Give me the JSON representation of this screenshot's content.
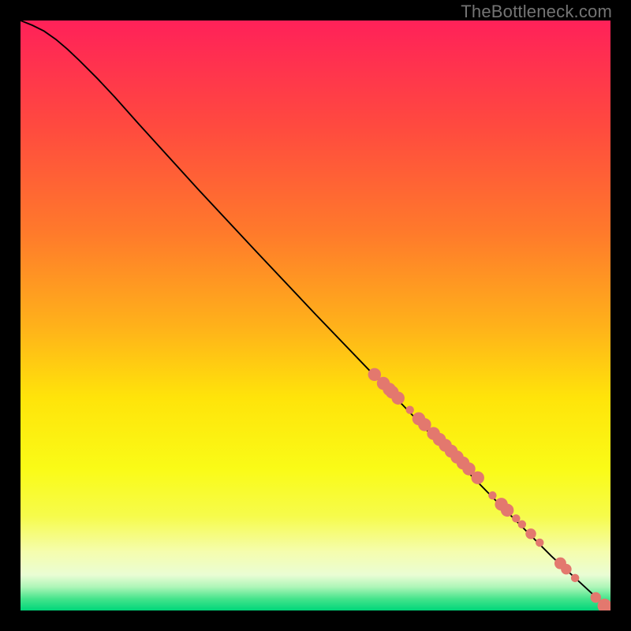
{
  "watermark": "TheBottleneck.com",
  "gradient": {
    "stops": [
      {
        "offset": 0.0,
        "color": "#ff2159"
      },
      {
        "offset": 0.18,
        "color": "#ff4a3f"
      },
      {
        "offset": 0.36,
        "color": "#ff7a2b"
      },
      {
        "offset": 0.52,
        "color": "#ffb21a"
      },
      {
        "offset": 0.64,
        "color": "#ffe40a"
      },
      {
        "offset": 0.76,
        "color": "#fafb17"
      },
      {
        "offset": 0.84,
        "color": "#f6fb4b"
      },
      {
        "offset": 0.9,
        "color": "#f5fdad"
      },
      {
        "offset": 0.94,
        "color": "#eafdd4"
      },
      {
        "offset": 0.96,
        "color": "#aef6b8"
      },
      {
        "offset": 0.98,
        "color": "#46e48c"
      },
      {
        "offset": 1.0,
        "color": "#00d67a"
      }
    ]
  },
  "chart_data": {
    "type": "line",
    "title": "",
    "xlabel": "",
    "ylabel": "",
    "xlim": [
      0,
      100
    ],
    "ylim": [
      0,
      100
    ],
    "series": [
      {
        "name": "curve",
        "points": [
          {
            "x": 0,
            "y": 100
          },
          {
            "x": 2,
            "y": 99.2
          },
          {
            "x": 4,
            "y": 98.2
          },
          {
            "x": 6,
            "y": 96.8
          },
          {
            "x": 8,
            "y": 95.1
          },
          {
            "x": 10,
            "y": 93.2
          },
          {
            "x": 13,
            "y": 90.2
          },
          {
            "x": 16,
            "y": 87.0
          },
          {
            "x": 20,
            "y": 82.5
          },
          {
            "x": 30,
            "y": 71.5
          },
          {
            "x": 40,
            "y": 60.8
          },
          {
            "x": 50,
            "y": 50.2
          },
          {
            "x": 60,
            "y": 39.8
          },
          {
            "x": 70,
            "y": 29.4
          },
          {
            "x": 80,
            "y": 19.2
          },
          {
            "x": 90,
            "y": 9.2
          },
          {
            "x": 100,
            "y": 0
          }
        ]
      }
    ],
    "scatter_points": [
      {
        "x": 60.0,
        "y": 40.0,
        "r": 1.1
      },
      {
        "x": 61.5,
        "y": 38.5,
        "r": 1.1
      },
      {
        "x": 62.5,
        "y": 37.5,
        "r": 1.1
      },
      {
        "x": 63.0,
        "y": 37.0,
        "r": 1.1
      },
      {
        "x": 64.0,
        "y": 36.0,
        "r": 1.1
      },
      {
        "x": 66.0,
        "y": 34.0,
        "r": 0.7
      },
      {
        "x": 67.5,
        "y": 32.5,
        "r": 1.1
      },
      {
        "x": 68.5,
        "y": 31.5,
        "r": 1.1
      },
      {
        "x": 70.0,
        "y": 30.0,
        "r": 1.1
      },
      {
        "x": 71.0,
        "y": 29.0,
        "r": 1.1
      },
      {
        "x": 72.0,
        "y": 28.0,
        "r": 1.1
      },
      {
        "x": 73.0,
        "y": 27.0,
        "r": 1.1
      },
      {
        "x": 74.0,
        "y": 26.0,
        "r": 1.1
      },
      {
        "x": 75.0,
        "y": 25.0,
        "r": 1.1
      },
      {
        "x": 76.0,
        "y": 24.0,
        "r": 1.1
      },
      {
        "x": 77.5,
        "y": 22.5,
        "r": 1.1
      },
      {
        "x": 80.0,
        "y": 19.5,
        "r": 0.7
      },
      {
        "x": 81.5,
        "y": 18.0,
        "r": 1.1
      },
      {
        "x": 82.5,
        "y": 17.0,
        "r": 1.1
      },
      {
        "x": 84.0,
        "y": 15.6,
        "r": 0.7
      },
      {
        "x": 85.0,
        "y": 14.6,
        "r": 0.7
      },
      {
        "x": 86.5,
        "y": 13.0,
        "r": 0.9
      },
      {
        "x": 88.0,
        "y": 11.5,
        "r": 0.7
      },
      {
        "x": 91.5,
        "y": 8.0,
        "r": 1.0
      },
      {
        "x": 92.5,
        "y": 7.0,
        "r": 0.9
      },
      {
        "x": 94.0,
        "y": 5.5,
        "r": 0.7
      },
      {
        "x": 97.5,
        "y": 2.2,
        "r": 0.9
      },
      {
        "x": 99.0,
        "y": 0.8,
        "r": 1.2
      },
      {
        "x": 100.0,
        "y": 0.0,
        "r": 1.2
      }
    ],
    "point_color": "#e3786e",
    "curve_color": "#000000"
  }
}
